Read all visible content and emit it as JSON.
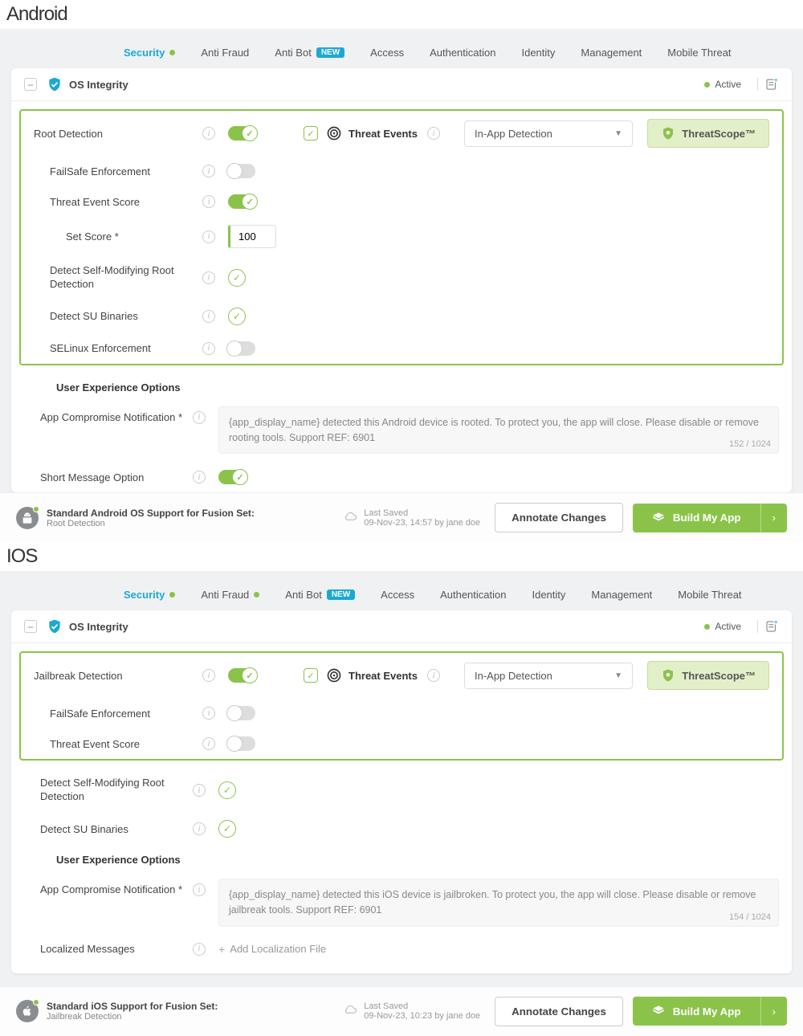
{
  "android": {
    "label": "Android",
    "tabs": [
      "Security",
      "Anti Fraud",
      "Anti Bot",
      "Access",
      "Authentication",
      "Identity",
      "Management",
      "Mobile Threat"
    ],
    "tabs_dot": [
      true,
      false,
      false,
      false,
      false,
      false,
      false,
      false
    ],
    "tab_new_badge": "NEW",
    "card_title": "OS Integrity",
    "status": "Active",
    "main_feature": "Root Detection",
    "threat_events_label": "Threat Events",
    "select_value": "In-App Detection",
    "threatscope": "ThreatScope™",
    "rows": {
      "failsafe": "FailSafe Enforcement",
      "threat_score": "Threat Event Score",
      "set_score": "Set Score  *",
      "set_score_value": "100",
      "self_mod": "Detect Self-Modifying Root Detection",
      "su_bin": "Detect SU Binaries",
      "selinux": "SELinux Enforcement"
    },
    "ux_heading": "User Experience Options",
    "notif_label": "App Compromise Notification  *",
    "notif_text": "{app_display_name} detected this Android device is rooted. To protect you, the app will close. Please disable or remove rooting tools. Support REF: 6901",
    "char_count": "152 / 1024",
    "short_msg": "Short Message Option",
    "footer_title": "Standard Android OS Support for Fusion Set:",
    "footer_sub": "Root Detection",
    "last_saved_label": "Last Saved",
    "last_saved_time": "09-Nov-23, 14:57 by jane doe",
    "annotate": "Annotate Changes",
    "build": "Build My App"
  },
  "ios": {
    "label": "IOS",
    "tabs": [
      "Security",
      "Anti Fraud",
      "Anti Bot",
      "Access",
      "Authentication",
      "Identity",
      "Management",
      "Mobile Threat"
    ],
    "tabs_dot": [
      true,
      true,
      false,
      false,
      false,
      false,
      false,
      false
    ],
    "tab_new_badge": "NEW",
    "card_title": "OS Integrity",
    "status": "Active",
    "main_feature": "Jailbreak Detection",
    "threat_events_label": "Threat Events",
    "select_value": "In-App Detection",
    "threatscope": "ThreatScope™",
    "rows": {
      "failsafe": "FailSafe Enforcement",
      "threat_score": "Threat Event Score",
      "self_mod": "Detect Self-Modifying Root Detection",
      "su_bin": "Detect SU Binaries"
    },
    "ux_heading": "User Experience Options",
    "notif_label": "App Compromise Notification  *",
    "notif_text": "{app_display_name} detected this iOS device is jailbroken. To protect you, the app will close. Please disable or remove jailbreak tools. Support REF: 6901",
    "char_count": "154 / 1024",
    "localized": "Localized Messages",
    "add_loc": "Add Localization File",
    "footer_title": "Standard iOS Support for Fusion Set:",
    "footer_sub": "Jailbreak Detection",
    "last_saved_label": "Last Saved",
    "last_saved_time": "09-Nov-23, 10:23 by jane doe",
    "annotate": "Annotate Changes",
    "build": "Build My App"
  }
}
